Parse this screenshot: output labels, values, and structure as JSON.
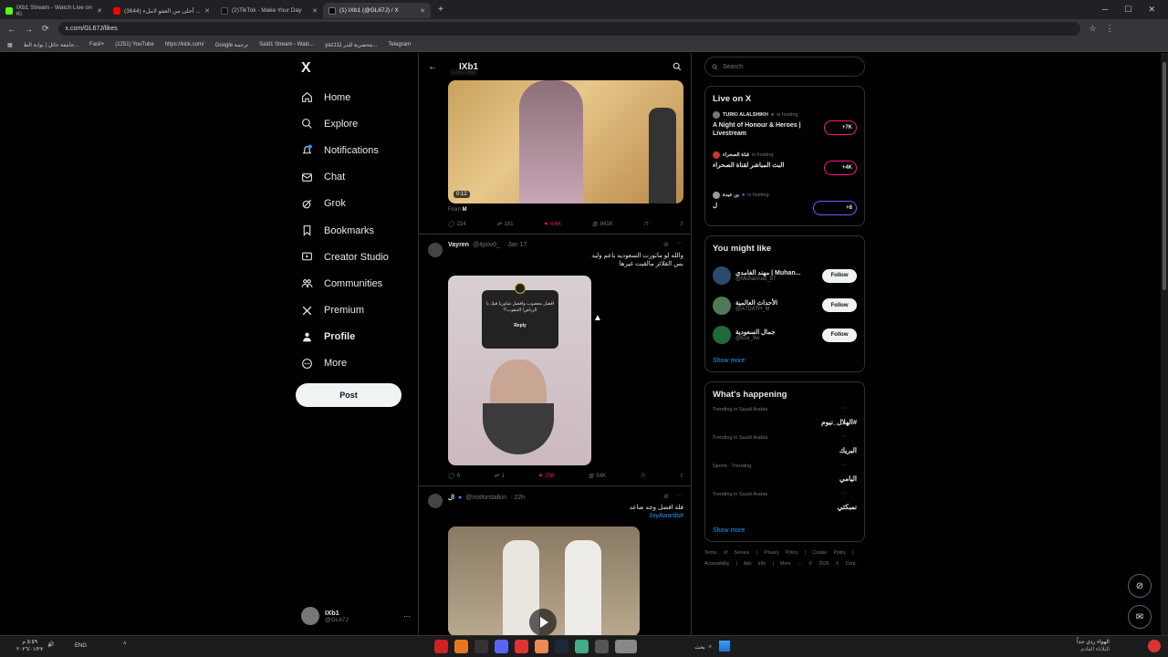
{
  "browser": {
    "tabs": [
      {
        "title": "IXb1 Stream - Watch Live on Ki",
        "color": "#53fc18"
      },
      {
        "title": "أحلى من العفو لاملء (3644) ...",
        "color": "#ff0000"
      },
      {
        "title": "(2)TikTok - Make Your Day",
        "color": "#ffffff"
      },
      {
        "title": "(1) IXb1 (@GL67J) / X",
        "color": "#ffffff"
      }
    ],
    "new_tab": "+",
    "url": "x.com/GL67J/likes",
    "bookmarks": [
      "جامعة حائل | بوابة الط...",
      "Fasil+",
      "(1251) YouTube",
      "https://kick.com/",
      "Google ترجمة",
      "Sald1 Stream - Watc...",
      "yaz111 محضرية للدر...",
      "Telegram"
    ]
  },
  "nav": {
    "logo": "X",
    "items": [
      {
        "label": "Home",
        "icon": "home-icon"
      },
      {
        "label": "Explore",
        "icon": "search-icon"
      },
      {
        "label": "Notifications",
        "icon": "bell-icon"
      },
      {
        "label": "Chat",
        "icon": "mail-icon"
      },
      {
        "label": "Grok",
        "icon": "grok-icon"
      },
      {
        "label": "Bookmarks",
        "icon": "bookmark-icon"
      },
      {
        "label": "Creator Studio",
        "icon": "creator-icon"
      },
      {
        "label": "Communities",
        "icon": "communities-icon"
      },
      {
        "label": "Premium",
        "icon": "x-icon"
      },
      {
        "label": "Profile",
        "icon": "person-icon"
      },
      {
        "label": "More",
        "icon": "more-icon"
      }
    ],
    "post_label": "Post",
    "account_name": "IXb1",
    "account_handle": "@GL67J",
    "account_more": "···"
  },
  "feed": {
    "header_name": "IXb1",
    "header_sub": "8,953 likes",
    "tweet1": {
      "duration": "0:12",
      "from_label": "From",
      "from_name": "M",
      "replies": "224",
      "retweets": "181",
      "likes": "4.6K",
      "views": "841K"
    },
    "tweet2": {
      "name": "Vayren",
      "handle": "@4pov0_",
      "date": "· Jan 17",
      "text_line1": "والله لو ماتورت السعوديه باعم وليد",
      "text_line2": "بس القلائز مالقيت غيرها",
      "card_text": "افضل معصوب وافضل شاوريا فيك يا الرياض! المقوب!؟",
      "card_reply": "Reply",
      "replies": "6",
      "retweets": "1",
      "likes": "256",
      "views": "54K"
    },
    "tweet3": {
      "name": "ال",
      "handle": "@notforstalkin",
      "date": "· 22h",
      "text_line1": "فلة افضل وجه ضاعد",
      "hashtag": "#JoyAwards"
    }
  },
  "sidebar": {
    "search_placeholder": "Search",
    "live_title": "Live on X",
    "live": [
      {
        "host": "TURKI ALALSHIKH",
        "status": "is hosting",
        "title": "A Night of Honour & Heroes | Livestream",
        "count": "+7K"
      },
      {
        "host": "قناة الصحراء",
        "status": "is hosting",
        "title": "البث المباشر لقناة الصحراء",
        "count": "+4K"
      },
      {
        "host": "بن عبدة",
        "status": "is hosting",
        "title": "ل",
        "count": "+8"
      }
    ],
    "wtf_title": "You might like",
    "wtf": [
      {
        "name": "مهند الغامدي | Muhan...",
        "handle": "@Muhannad_b7",
        "button": "Follow"
      },
      {
        "name": "الأحداث العالمية",
        "handle": "@A7DATH_M",
        "button": "Follow"
      },
      {
        "name": "جمال السعودية",
        "handle": "@ksa_9w",
        "button": "Follow"
      }
    ],
    "show_more": "Show more",
    "trends_title": "What's happening",
    "trends": [
      {
        "context": "Trending in Saudi Arabia",
        "tag": "#الهلال_نيوم"
      },
      {
        "context": "Trending in Saudi Arabia",
        "tag": "البريك"
      },
      {
        "context": "Sports · Trending",
        "tag": "اليامي"
      },
      {
        "context": "Trending in Saudi Arabia",
        "tag": "نمبكتي"
      }
    ],
    "footer": "Terms of Service | Privacy Policy | Cookie Policy | Accessibility | Ads info | More ··· © 2026 X Corp."
  },
  "taskbar": {
    "lang": "ENG",
    "time": "٥:٥٩ م",
    "date": "٢٠٢٦/٠١/٢٧",
    "search": "بحث",
    "weather": "الهواء رذي جداً",
    "weather_sub": "الثلاثاء القادم"
  }
}
